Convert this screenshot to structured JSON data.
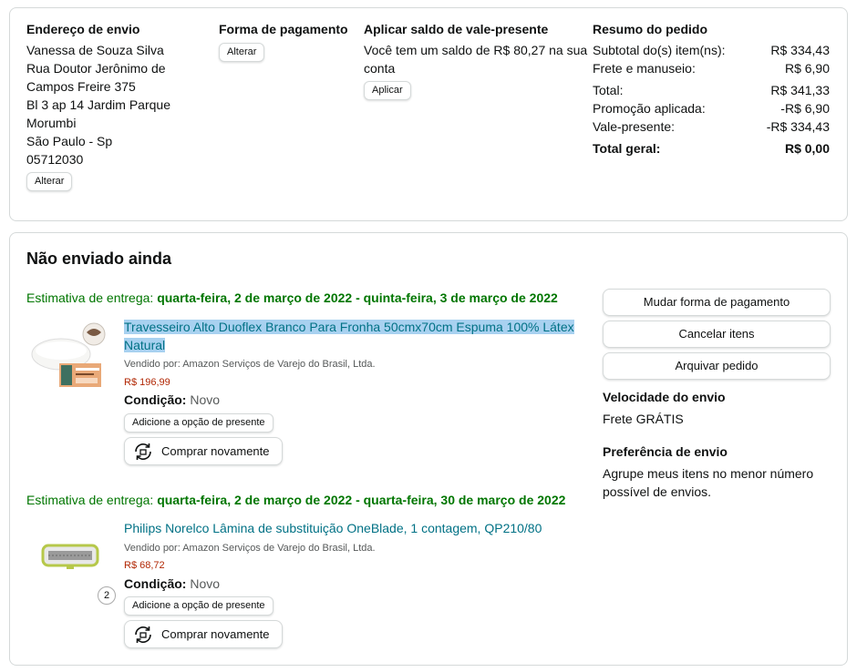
{
  "shipping": {
    "heading": "Endereço de envio",
    "lines": [
      "Vanessa de Souza Silva",
      "Rua Doutor Jerônimo de",
      "Campos Freire 375",
      "Bl 3 ap 14 Jardim Parque",
      "Morumbi",
      "São Paulo - Sp",
      "05712030"
    ],
    "change_label": "Alterar"
  },
  "payment": {
    "heading": "Forma de pagamento",
    "change_label": "Alterar"
  },
  "giftcard": {
    "heading": "Aplicar saldo de vale-presente",
    "text": "Você tem um saldo de R$ 80,27 na sua conta",
    "apply_label": "Aplicar"
  },
  "summary": {
    "heading": "Resumo do pedido",
    "rows": [
      {
        "label": "Subtotal do(s) item(ns):",
        "value": "R$ 334,43"
      },
      {
        "label": "Frete e manuseio:",
        "value": "R$ 6,90"
      },
      {
        "label": "Total:",
        "value": "R$ 341,33"
      },
      {
        "label": "Promoção aplicada:",
        "value": "-R$ 6,90"
      },
      {
        "label": "Vale-presente:",
        "value": "-R$ 334,43"
      }
    ],
    "grand_total_label": "Total geral:",
    "grand_total_value": "R$ 0,00"
  },
  "order": {
    "title": "Não enviado ainda",
    "delivery_prefix": "Estimativa de entrega: ",
    "items": [
      {
        "delivery_range": "quarta-feira, 2 de março de 2022 - quinta-feira, 3 de março de 2022",
        "title_line1": "Travesseiro Alto Duoflex Branco Para Fronha 50cmx70cm Espuma 100% Látex",
        "title_line2": "Natural",
        "seller": "Vendido por: Amazon Serviços de Varejo do Brasil, Ltda.",
        "price": "R$ 196,99",
        "condition_label": "Condição:",
        "condition_value": " Novo",
        "gift_label": "Adicione a opção de presente",
        "buy_again_label": "Comprar novamente"
      },
      {
        "delivery_range": "quarta-feira, 2 de março de 2022 - quarta-feira, 30 de março de 2022",
        "title_line1": "Philips Norelco Lâmina de substituição OneBlade, 1 contagem, QP210/80",
        "seller": "Vendido por: Amazon Serviços de Varejo do Brasil, Ltda.",
        "price": "R$ 68,72",
        "quantity": "2",
        "condition_label": "Condição:",
        "condition_value": " Novo",
        "gift_label": "Adicione a opção de presente",
        "buy_again_label": "Comprar novamente"
      }
    ],
    "actions": [
      "Mudar forma de pagamento",
      "Cancelar itens",
      "Arquivar pedido"
    ],
    "shipping_speed_heading": "Velocidade do envio",
    "shipping_speed_value": "Frete GRÁTIS",
    "shipping_pref_heading": "Preferência de envio",
    "shipping_pref_value": "Agrupe meus itens no menor número possível de envios."
  },
  "colors": {
    "delivery_green": "#007600",
    "link_teal": "#007185",
    "price_red": "#b12704",
    "selection_blue": "#a8d1f0"
  }
}
